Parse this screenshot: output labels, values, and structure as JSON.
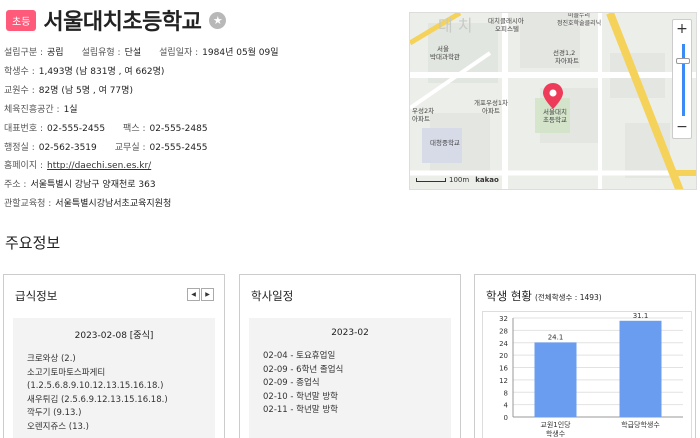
{
  "header": {
    "badge": "초등",
    "title": "서울대치초등학교",
    "star_icon": "star-icon"
  },
  "info": {
    "foundation_type_label": "설립구분 :",
    "foundation_type": "공립",
    "foundation_form_label": "설립유형 :",
    "foundation_form": "단설",
    "foundation_date_label": "설립일자 :",
    "foundation_date": "1984년 05월 09일",
    "students_label": "학생수 :",
    "students": "1,493명 (남 831명 , 여 662명)",
    "teachers_label": "교원수 :",
    "teachers": "82명 (남 5명 , 여 77명)",
    "gym_label": "체육진흥공간 :",
    "gym": "1실",
    "phone_label": "대표번호 :",
    "phone": "02-555-2455",
    "fax_label": "팩스 :",
    "fax": "02-555-2485",
    "admin_label": "행정실 :",
    "admin": "02-562-3519",
    "office_label": "교무실 :",
    "office": "02-555-2455",
    "homepage_label": "홈페이지 :",
    "homepage": "http://daechi.sen.es.kr/",
    "address_label": "주소 :",
    "address": "서울특별시 강남구 양재천로 363",
    "authority_label": "관할교육청 :",
    "authority": "서울특별시강남서초교육지원청"
  },
  "map": {
    "labels": {
      "daechi_big": "대 치",
      "clubbis": "대치클래시아\n오피스텔",
      "museum": "서울\n박대과학관",
      "apt_1_2": "선경1,2\n차아파트",
      "gaepo": "개포우성1차\n아파트",
      "school": "서울대치\n초등학교",
      "woosung2": "우성2차\n아파트",
      "daechi_middle": "대청중학교",
      "hospital": "미플누리\n정진호학술클리닉"
    },
    "zoom_in": "+",
    "zoom_out": "−",
    "scale": "100m",
    "brand": "kakao"
  },
  "section_title": "주요정보",
  "meal": {
    "title": "급식정보",
    "prev": "◀",
    "next": "▶",
    "date": "2023-02-08 [중식]",
    "items": [
      "크로와상 (2.)",
      "소고기토마토스파게티",
      "(1.2.5.6.8.9.10.12.13.15.16.18.)",
      "새우튀김 (2.5.6.9.12.13.15.16.18.)",
      "깍두기 (9.13.)",
      "오렌지쥬스 (13.)"
    ]
  },
  "schedule": {
    "title": "학사일정",
    "month": "2023-02",
    "items": [
      "02-04 - 토요휴업일",
      "02-09 - 6학년 졸업식",
      "02-09 - 종업식",
      "02-10 - 학년말 방학",
      "02-11 - 학년말 방학"
    ]
  },
  "students_chart": {
    "title": "학생 현황",
    "subtitle": "(전체학생수 : 1493)"
  },
  "chart_data": {
    "type": "bar",
    "title": "학생 현황",
    "categories": [
      "교원1인당\n학생수",
      "학급당학생수"
    ],
    "values": [
      24.1,
      31.1
    ],
    "ylim": [
      0,
      32
    ],
    "yticks": [
      0,
      4,
      8,
      12,
      16,
      20,
      24,
      28,
      32
    ],
    "bar_color": "#6a9cf0",
    "grid": true
  }
}
